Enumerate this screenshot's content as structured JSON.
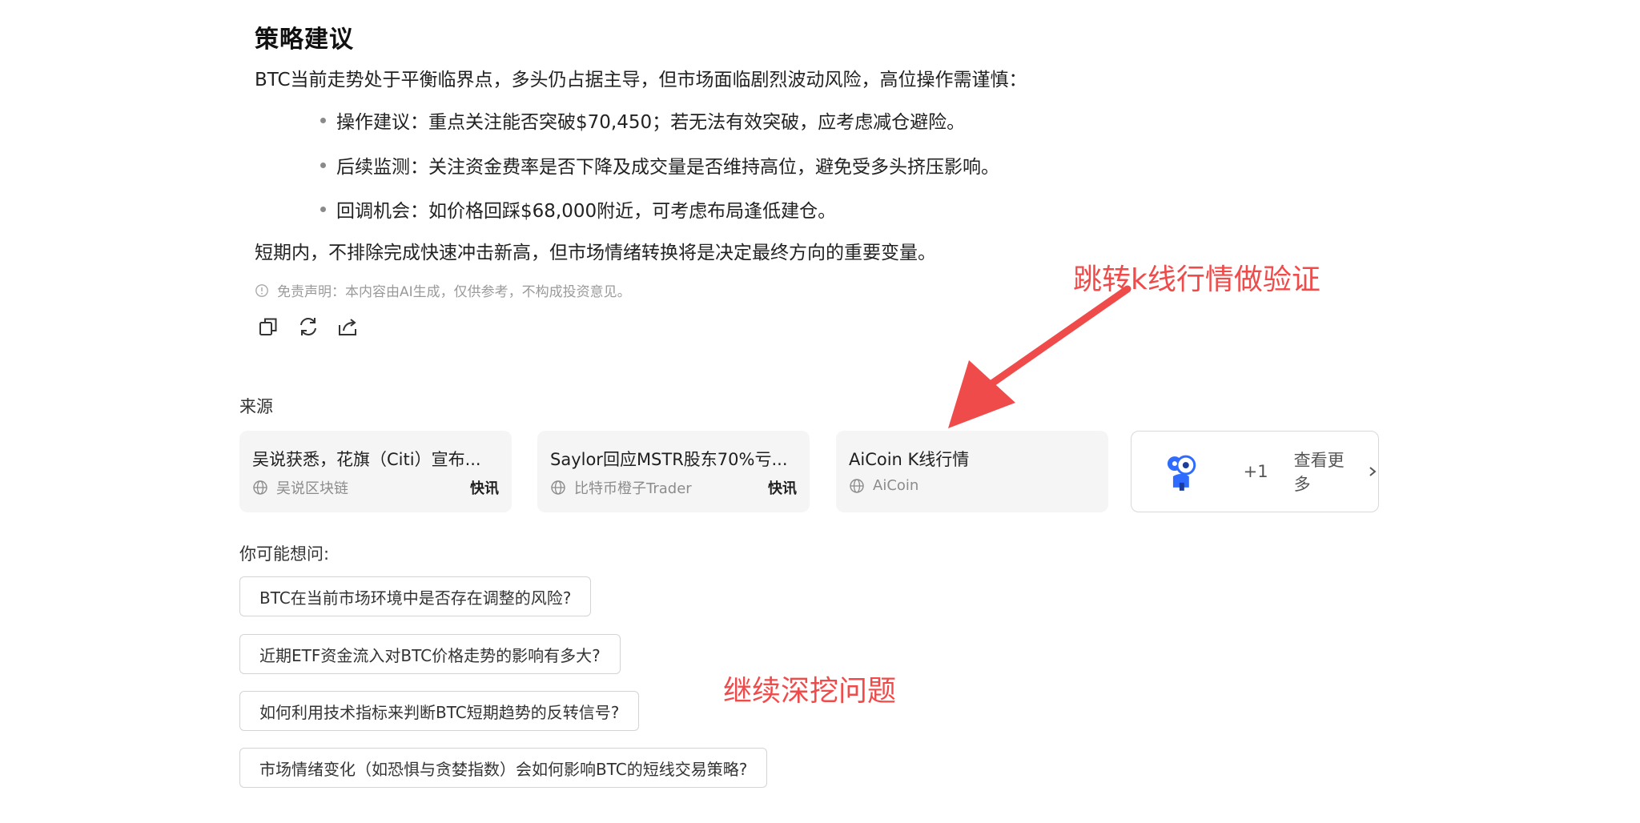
{
  "strategy": {
    "heading": "策略建议",
    "intro": "BTC当前走势处于平衡临界点，多头仍占据主导，但市场面临剧烈波动风险，高位操作需谨慎：",
    "bullets": [
      "操作建议：重点关注能否突破$70,450；若无法有效突破，应考虑减仓避险。",
      "后续监测：关注资金费率是否下降及成交量是否维持高位，避免受多头挤压影响。",
      "回调机会：如价格回踩$68,000附近，可考虑布局逢低建仓。"
    ],
    "summary": "短期内，不排除完成快速冲击新高，但市场情绪转换将是决定最终方向的重要变量。",
    "disclaimer": "免责声明：本内容由AI生成，仅供参考，不构成投资意见。"
  },
  "actions": {
    "icons": [
      "copy-icon",
      "refresh-icon",
      "share-icon"
    ]
  },
  "sources": {
    "label": "来源",
    "cards": [
      {
        "title": "吴说获悉，花旗（Citi）宣布...",
        "source": "吴说区块链",
        "tag": "快讯"
      },
      {
        "title": "Saylor回应MSTR股东70%亏...",
        "source": "比特币橙子Trader",
        "tag": "快讯"
      },
      {
        "title": "AiCoin K线行情",
        "source": "AiCoin",
        "tag": ""
      }
    ],
    "more": {
      "count": "+1",
      "label": "查看更多"
    }
  },
  "suggestions": {
    "label": "你可能想问:",
    "items": [
      "BTC在当前市场环境中是否存在调整的风险?",
      "近期ETF资金流入对BTC价格走势的影响有多大?",
      "如何利用技术指标来判断BTC短期趋势的反转信号?",
      "市场情绪变化（如恐惧与贪婪指数）会如何影响BTC的短线交易策略?"
    ]
  },
  "annotations": {
    "kline": "跳转k线行情做验证",
    "dig": "继续深挖问题",
    "color": "#f04b4b"
  }
}
